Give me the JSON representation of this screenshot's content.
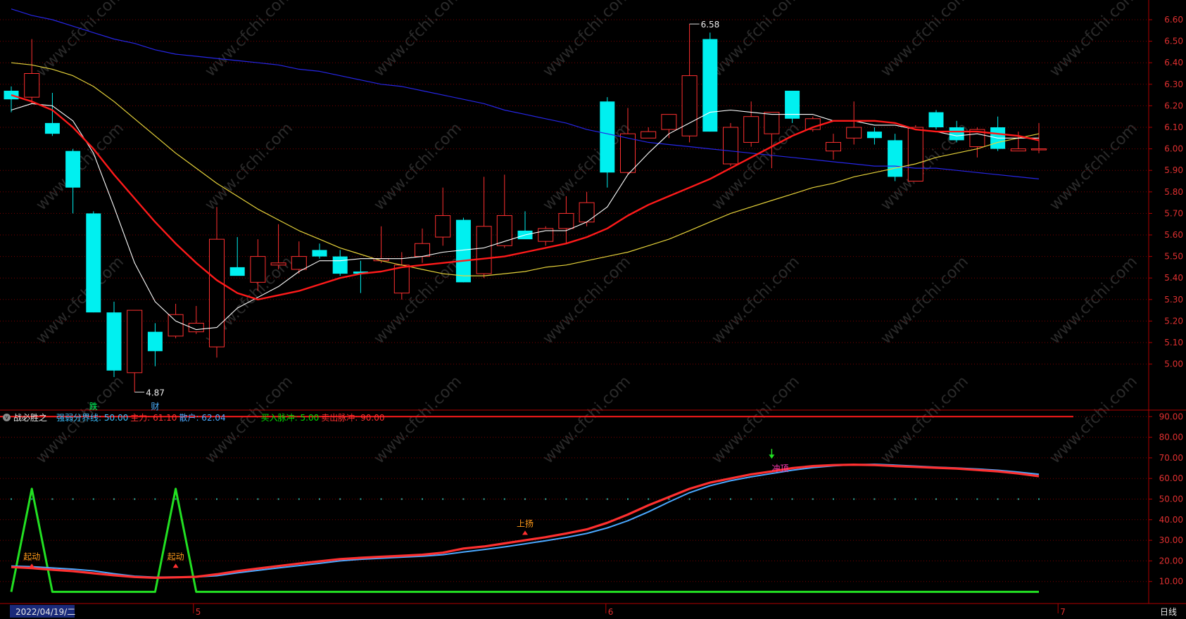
{
  "indicator": {
    "name": "战必胜之",
    "items": [
      {
        "label": "强弱分界线:",
        "value": "50.00",
        "color": "#3cc0ff"
      },
      {
        "label": "主力:",
        "value": "61.10",
        "color": "#ff3030"
      },
      {
        "label": "散户:",
        "value": "62.04",
        "color": "#4aa8ff"
      },
      {
        "label": "买入脉冲:",
        "value": "5.00",
        "color": "#00e000"
      },
      {
        "label": "卖出脉冲:",
        "value": "90.00",
        "color": "#ff3030"
      }
    ]
  },
  "status_bar": {
    "date": "2022/04/19/二",
    "period": "日线"
  },
  "watermark": "www.cfchi.com",
  "colors": {
    "up": "#ff3030",
    "down": "#00f0f0",
    "ma5": "#ffffff",
    "ma10": "#ff1a1a",
    "ma20": "#e6d23a",
    "ma60": "#2626e6",
    "bg": "#000000",
    "grid": "#7a0000",
    "axis": "#b00000"
  },
  "chart_data": [
    {
      "type": "candlestick",
      "y_axis": {
        "min": 4.9,
        "max": 6.65,
        "ticks": [
          "6.60",
          "6.50",
          "6.40",
          "6.30",
          "6.20",
          "6.10",
          "6.00",
          "5.90",
          "5.80",
          "5.70",
          "5.60",
          "5.50",
          "5.40",
          "5.30",
          "5.20",
          "5.10",
          "5.00"
        ]
      },
      "candles": [
        {
          "o": 6.27,
          "h": 6.29,
          "l": 6.17,
          "c": 6.23
        },
        {
          "o": 6.24,
          "h": 6.51,
          "l": 6.21,
          "c": 6.35
        },
        {
          "o": 6.12,
          "h": 6.26,
          "l": 6.06,
          "c": 6.07
        },
        {
          "o": 5.99,
          "h": 6.0,
          "l": 5.7,
          "c": 5.82
        },
        {
          "o": 5.7,
          "h": 5.71,
          "l": 5.24,
          "c": 5.24
        },
        {
          "o": 5.24,
          "h": 5.29,
          "l": 4.94,
          "c": 4.97
        },
        {
          "o": 4.96,
          "h": 5.25,
          "l": 4.87,
          "c": 5.25
        },
        {
          "o": 5.15,
          "h": 5.19,
          "l": 4.99,
          "c": 5.06
        },
        {
          "o": 5.13,
          "h": 5.28,
          "l": 5.12,
          "c": 5.23
        },
        {
          "o": 5.15,
          "h": 5.27,
          "l": 5.14,
          "c": 5.19
        },
        {
          "o": 5.08,
          "h": 5.73,
          "l": 5.03,
          "c": 5.58
        },
        {
          "o": 5.45,
          "h": 5.59,
          "l": 5.43,
          "c": 5.41
        },
        {
          "o": 5.38,
          "h": 5.58,
          "l": 5.34,
          "c": 5.5
        },
        {
          "o": 5.46,
          "h": 5.65,
          "l": 5.44,
          "c": 5.47
        },
        {
          "o": 5.44,
          "h": 5.57,
          "l": 5.42,
          "c": 5.5
        },
        {
          "o": 5.53,
          "h": 5.56,
          "l": 5.49,
          "c": 5.5
        },
        {
          "o": 5.5,
          "h": 5.53,
          "l": 5.41,
          "c": 5.42
        },
        {
          "o": 5.43,
          "h": 5.48,
          "l": 5.33,
          "c": 5.42
        },
        {
          "o": 5.48,
          "h": 5.64,
          "l": 5.47,
          "c": 5.49
        },
        {
          "o": 5.33,
          "h": 5.52,
          "l": 5.3,
          "c": 5.46
        },
        {
          "o": 5.5,
          "h": 5.63,
          "l": 5.47,
          "c": 5.56
        },
        {
          "o": 5.59,
          "h": 5.82,
          "l": 5.55,
          "c": 5.69
        },
        {
          "o": 5.67,
          "h": 5.68,
          "l": 5.38,
          "c": 5.38
        },
        {
          "o": 5.42,
          "h": 5.87,
          "l": 5.4,
          "c": 5.64
        },
        {
          "o": 5.55,
          "h": 5.88,
          "l": 5.54,
          "c": 5.69
        },
        {
          "o": 5.62,
          "h": 5.71,
          "l": 5.59,
          "c": 5.58
        },
        {
          "o": 5.57,
          "h": 5.64,
          "l": 5.55,
          "c": 5.63
        },
        {
          "o": 5.63,
          "h": 5.78,
          "l": 5.56,
          "c": 5.7
        },
        {
          "o": 5.66,
          "h": 5.8,
          "l": 5.64,
          "c": 5.75
        },
        {
          "o": 6.22,
          "h": 6.24,
          "l": 5.82,
          "c": 5.89
        },
        {
          "o": 5.89,
          "h": 6.19,
          "l": 5.88,
          "c": 6.07
        },
        {
          "o": 6.05,
          "h": 6.1,
          "l": 6.05,
          "c": 6.08
        },
        {
          "o": 6.09,
          "h": 6.16,
          "l": 6.05,
          "c": 6.16
        },
        {
          "o": 6.06,
          "h": 6.58,
          "l": 6.03,
          "c": 6.34
        },
        {
          "o": 6.51,
          "h": 6.54,
          "l": 6.08,
          "c": 6.08
        },
        {
          "o": 5.93,
          "h": 6.12,
          "l": 5.92,
          "c": 6.1
        },
        {
          "o": 6.03,
          "h": 6.22,
          "l": 6.01,
          "c": 6.15
        },
        {
          "o": 6.07,
          "h": 6.17,
          "l": 5.91,
          "c": 6.17
        },
        {
          "o": 6.27,
          "h": 6.27,
          "l": 6.12,
          "c": 6.14
        },
        {
          "o": 6.09,
          "h": 6.15,
          "l": 6.08,
          "c": 6.14
        },
        {
          "o": 5.99,
          "h": 6.07,
          "l": 5.95,
          "c": 6.03
        },
        {
          "o": 6.05,
          "h": 6.22,
          "l": 6.02,
          "c": 6.1
        },
        {
          "o": 6.08,
          "h": 6.1,
          "l": 6.02,
          "c": 6.05
        },
        {
          "o": 6.04,
          "h": 6.07,
          "l": 5.85,
          "c": 5.87
        },
        {
          "o": 5.85,
          "h": 6.11,
          "l": 5.85,
          "c": 6.1
        },
        {
          "o": 6.17,
          "h": 6.18,
          "l": 6.09,
          "c": 6.1
        },
        {
          "o": 6.1,
          "h": 6.13,
          "l": 6.03,
          "c": 6.04
        },
        {
          "o": 6.01,
          "h": 6.1,
          "l": 5.96,
          "c": 6.09
        },
        {
          "o": 6.1,
          "h": 6.15,
          "l": 5.99,
          "c": 6.0
        },
        {
          "o": 5.99,
          "h": 6.08,
          "l": 5.99,
          "c": 6.0
        },
        {
          "o": 6.0,
          "h": 6.12,
          "l": 5.98,
          "c": 6.0
        }
      ],
      "ma5": [
        6.18,
        6.21,
        6.2,
        6.13,
        5.98,
        5.73,
        5.47,
        5.29,
        5.2,
        5.16,
        5.17,
        5.26,
        5.31,
        5.36,
        5.43,
        5.48,
        5.48,
        5.49,
        5.49,
        5.49,
        5.5,
        5.52,
        5.53,
        5.54,
        5.57,
        5.6,
        5.62,
        5.62,
        5.66,
        5.73,
        5.88,
        5.98,
        6.07,
        6.12,
        6.17,
        6.18,
        6.17,
        6.16,
        6.16,
        6.16,
        6.13,
        6.13,
        6.11,
        6.11,
        6.09,
        6.08,
        6.06,
        6.07,
        6.05,
        6.05,
        6.05
      ],
      "ma10": [
        6.25,
        6.22,
        6.18,
        6.1,
        6.0,
        5.88,
        5.77,
        5.66,
        5.56,
        5.47,
        5.39,
        5.33,
        5.3,
        5.32,
        5.34,
        5.37,
        5.4,
        5.42,
        5.43,
        5.45,
        5.46,
        5.47,
        5.48,
        5.49,
        5.5,
        5.52,
        5.54,
        5.56,
        5.59,
        5.63,
        5.69,
        5.74,
        5.78,
        5.82,
        5.86,
        5.91,
        5.96,
        6.01,
        6.06,
        6.1,
        6.13,
        6.13,
        6.13,
        6.12,
        6.09,
        6.08,
        6.08,
        6.08,
        6.07,
        6.06,
        6.04
      ],
      "ma20": [
        6.4,
        6.39,
        6.37,
        6.34,
        6.29,
        6.22,
        6.14,
        6.06,
        5.98,
        5.91,
        5.84,
        5.78,
        5.72,
        5.67,
        5.62,
        5.58,
        5.54,
        5.51,
        5.48,
        5.46,
        5.44,
        5.42,
        5.41,
        5.41,
        5.42,
        5.43,
        5.45,
        5.46,
        5.48,
        5.5,
        5.52,
        5.55,
        5.58,
        5.62,
        5.66,
        5.7,
        5.73,
        5.76,
        5.79,
        5.82,
        5.84,
        5.87,
        5.89,
        5.91,
        5.93,
        5.96,
        5.98,
        6.0,
        6.03,
        6.05,
        6.07
      ],
      "ma60": [
        6.65,
        6.62,
        6.6,
        6.57,
        6.54,
        6.51,
        6.49,
        6.46,
        6.44,
        6.43,
        6.42,
        6.41,
        6.4,
        6.39,
        6.37,
        6.36,
        6.34,
        6.32,
        6.3,
        6.29,
        6.27,
        6.25,
        6.23,
        6.21,
        6.18,
        6.16,
        6.14,
        6.12,
        6.09,
        6.07,
        6.05,
        6.03,
        6.02,
        6.01,
        6.0,
        5.99,
        5.98,
        5.97,
        5.96,
        5.95,
        5.94,
        5.93,
        5.92,
        5.92,
        5.91,
        5.91,
        5.9,
        5.89,
        5.88,
        5.87,
        5.86
      ],
      "annotations": [
        {
          "text": "4.87",
          "index": 6,
          "value": 4.87
        },
        {
          "text": "6.58",
          "index": 33,
          "value": 6.58
        },
        {
          "text": "跌",
          "index": 4,
          "color": "#00ff60"
        },
        {
          "text": "财",
          "index": 7,
          "color": "#4ab0ff"
        }
      ]
    },
    {
      "type": "line",
      "y_axis": {
        "min": 0,
        "max": 95,
        "ticks": [
          "90.00",
          "80.00",
          "70.00",
          "60.00",
          "50.00",
          "40.00",
          "30.00",
          "20.00",
          "10.00"
        ]
      },
      "strength_line": 50,
      "sell_pulse": 90,
      "series": [
        {
          "name": "主力",
          "color": "#ff3030",
          "values": [
            17,
            16.5,
            15.7,
            15,
            14,
            13,
            12.2,
            11.8,
            12,
            12.3,
            13.5,
            15,
            16.3,
            17.5,
            18.7,
            19.8,
            20.9,
            21.5,
            22,
            22.5,
            23,
            24,
            26,
            27,
            28.5,
            30,
            31.5,
            33.3,
            35.3,
            38.5,
            42.5,
            47,
            51,
            55,
            58,
            60,
            62,
            63.4,
            65,
            66,
            66.5,
            66.7,
            66.5,
            66,
            65.6,
            65.2,
            64.8,
            64.1,
            63.4,
            62.4,
            61.1
          ]
        },
        {
          "name": "散户",
          "color": "#4aa8ff",
          "values": [
            17.5,
            17.2,
            16.6,
            16,
            15.2,
            13.8,
            12.6,
            12.1,
            12.2,
            12.2,
            12.8,
            14.2,
            15.4,
            16.6,
            17.7,
            18.8,
            20,
            20.8,
            21.3,
            21.8,
            22.3,
            23,
            24.3,
            25.5,
            26.8,
            28.3,
            29.8,
            31.4,
            33.3,
            36,
            39.5,
            43.8,
            48.6,
            53.1,
            56.5,
            58.9,
            60.8,
            62.4,
            64,
            65.3,
            66.1,
            66.7,
            66.9,
            66.5,
            66,
            65.5,
            65.1,
            64.6,
            64,
            63.1,
            62.04
          ]
        },
        {
          "name": "脉冲",
          "color": "#22e022",
          "values": [
            5,
            55,
            5,
            5,
            5,
            5,
            5,
            5,
            55,
            5,
            5,
            5,
            5,
            5,
            5,
            5,
            5,
            5,
            5,
            5,
            5,
            5,
            5,
            5,
            5,
            5,
            5,
            5,
            5,
            5,
            5,
            5,
            5,
            5,
            5,
            5,
            5,
            5,
            5,
            5,
            5,
            5,
            5,
            5,
            5,
            5,
            5,
            5,
            5,
            5,
            5
          ]
        }
      ],
      "labels": [
        {
          "text": "起动",
          "index": 1,
          "value": 18,
          "color": "#ff9a1a",
          "arrow": "up"
        },
        {
          "text": "起动",
          "index": 8,
          "value": 18,
          "color": "#ff9a1a",
          "arrow": "up"
        },
        {
          "text": "上扬",
          "index": 25,
          "value": 34,
          "color": "#ff9a1a",
          "arrow": "up"
        },
        {
          "text": "冲顶",
          "index": 37,
          "value": 60,
          "color": "#ff3cb4",
          "arrow": "down"
        }
      ]
    }
  ],
  "x_axis_labels": [
    {
      "text": "5",
      "index": 9
    },
    {
      "text": "6",
      "index": 29
    },
    {
      "text": "7",
      "index": 51
    }
  ]
}
